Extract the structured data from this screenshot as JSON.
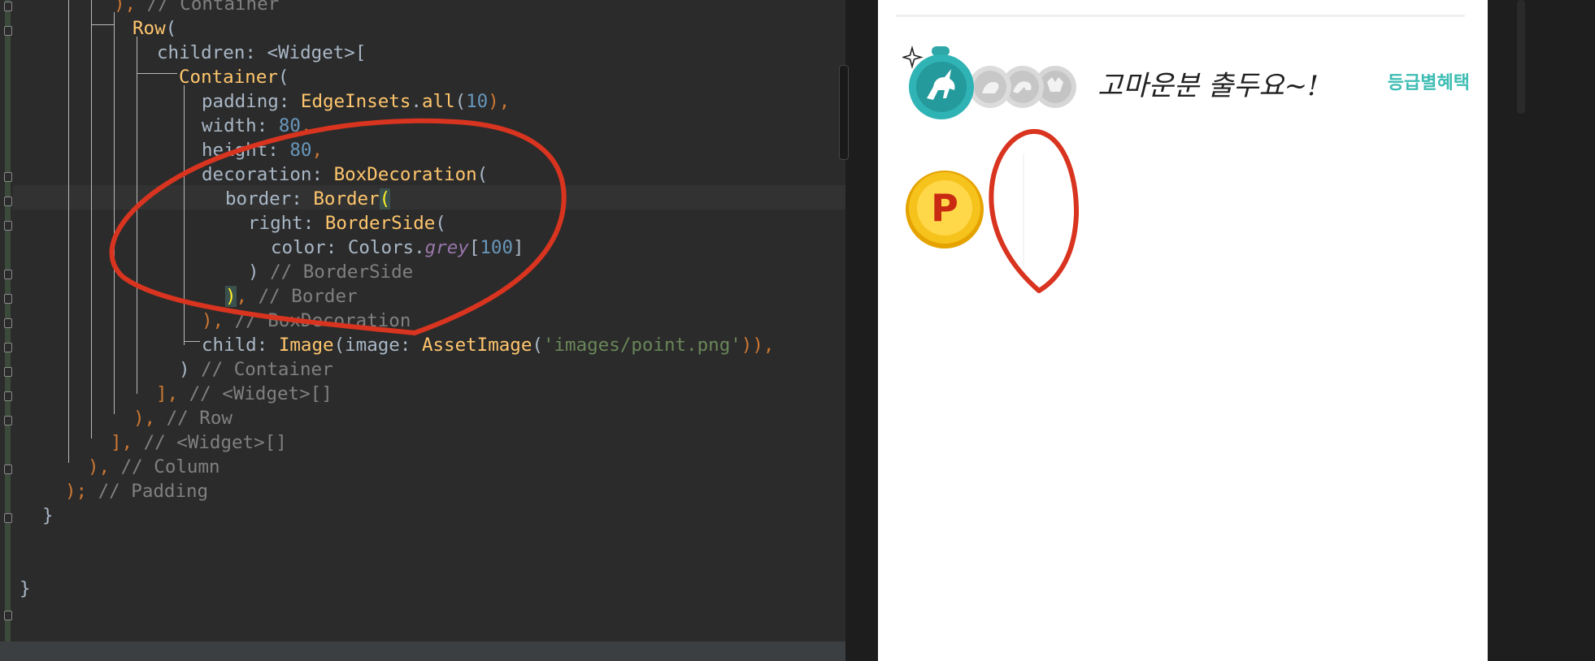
{
  "editor": {
    "lines": [
      [
        {
          "t": "), ",
          "c": "kw"
        },
        {
          "t": "// Container",
          "c": "com"
        }
      ],
      [
        {
          "t": "Row",
          "c": "cls"
        },
        {
          "t": "(",
          "c": "plain"
        }
      ],
      [
        {
          "t": "children: ",
          "c": "plain"
        },
        {
          "t": "<Widget>[",
          "c": "plain"
        }
      ],
      [
        {
          "t": "Container",
          "c": "cls"
        },
        {
          "t": "(",
          "c": "plain"
        }
      ],
      [
        {
          "t": "padding: ",
          "c": "plain"
        },
        {
          "t": "EdgeInsets",
          "c": "cls"
        },
        {
          "t": ".",
          "c": "plain"
        },
        {
          "t": "all",
          "c": "cls"
        },
        {
          "t": "(",
          "c": "plain"
        },
        {
          "t": "10",
          "c": "num"
        },
        {
          "t": "),",
          "c": "kw"
        }
      ],
      [
        {
          "t": "width: ",
          "c": "plain"
        },
        {
          "t": "80",
          "c": "num"
        },
        {
          "t": ",",
          "c": "kw"
        }
      ],
      [
        {
          "t": "height: ",
          "c": "plain"
        },
        {
          "t": "80",
          "c": "num"
        },
        {
          "t": ",",
          "c": "kw"
        }
      ],
      [
        {
          "t": "decoration: ",
          "c": "plain"
        },
        {
          "t": "BoxDecoration",
          "c": "cls"
        },
        {
          "t": "(",
          "c": "plain"
        }
      ],
      [
        {
          "t": "border: ",
          "c": "plain"
        },
        {
          "t": "Border",
          "c": "cls"
        },
        {
          "t": "(",
          "c": "brk-hl"
        }
      ],
      [
        {
          "t": "right: ",
          "c": "plain"
        },
        {
          "t": "BorderSide",
          "c": "cls"
        },
        {
          "t": "(",
          "c": "plain"
        }
      ],
      [
        {
          "t": "color: ",
          "c": "plain"
        },
        {
          "t": "Colors.",
          "c": "plain"
        },
        {
          "t": "grey",
          "c": "ital"
        },
        {
          "t": "[",
          "c": "plain"
        },
        {
          "t": "100",
          "c": "num"
        },
        {
          "t": "]",
          "c": "plain"
        }
      ],
      [
        {
          "t": ") ",
          "c": "plain"
        },
        {
          "t": "// BorderSide",
          "c": "com"
        }
      ],
      [
        {
          "t": ")",
          "c": "brk-hl"
        },
        {
          "t": ", ",
          "c": "kw"
        },
        {
          "t": "// Border",
          "c": "com"
        }
      ],
      [
        {
          "t": "),",
          "c": "kw"
        },
        {
          "t": " // BoxDecoration",
          "c": "com"
        }
      ],
      [
        {
          "t": "child: ",
          "c": "plain"
        },
        {
          "t": "Image",
          "c": "cls"
        },
        {
          "t": "(image: ",
          "c": "plain"
        },
        {
          "t": "AssetImage",
          "c": "cls"
        },
        {
          "t": "(",
          "c": "plain"
        },
        {
          "t": "'images/point.png'",
          "c": "str"
        },
        {
          "t": ")),",
          "c": "kw"
        }
      ],
      [
        {
          "t": ") ",
          "c": "plain"
        },
        {
          "t": "// Container",
          "c": "com"
        }
      ],
      [
        {
          "t": "],",
          "c": "kw"
        },
        {
          "t": " // <Widget>[]",
          "c": "com"
        }
      ],
      [
        {
          "t": "),",
          "c": "kw"
        },
        {
          "t": " // Row",
          "c": "com"
        }
      ],
      [
        {
          "t": "],",
          "c": "kw"
        },
        {
          "t": " // <Widget>[]",
          "c": "com"
        }
      ],
      [
        {
          "t": "),",
          "c": "kw"
        },
        {
          "t": " // Column",
          "c": "com"
        }
      ],
      [
        {
          "t": ");",
          "c": "kw"
        },
        {
          "t": " // Padding",
          "c": "com"
        }
      ],
      [
        {
          "t": "}",
          "c": "plain"
        }
      ],
      [
        {
          "t": "",
          "c": "plain"
        }
      ],
      [
        {
          "t": "",
          "c": "plain"
        }
      ],
      [
        {
          "t": "}",
          "c": "plain"
        }
      ]
    ]
  },
  "phone": {
    "greeting": "고마운분 출두요~!",
    "benefit_link": "등급별혜택",
    "point_symbol": "P",
    "badges": [
      "unicorn-badge-icon",
      "grade-badge-icon",
      "grade-badge-icon",
      "grade-badge-icon"
    ]
  },
  "colors": {
    "teal": "#3ebdb4",
    "annotation_red": "#d8341f",
    "coin_gold": "#f6c21c"
  }
}
